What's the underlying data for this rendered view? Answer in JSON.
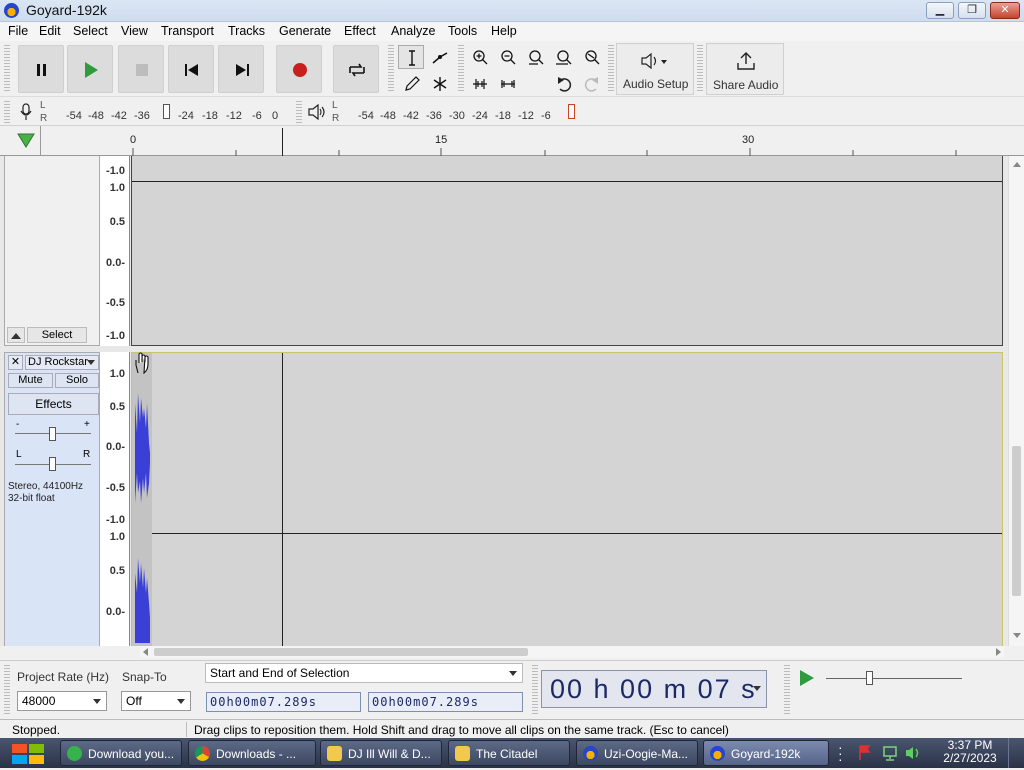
{
  "window": {
    "title": "Goyard-192k",
    "min_label": "▭",
    "max_label": "⧉",
    "close_label": "✕"
  },
  "menu": [
    "File",
    "Edit",
    "Select",
    "View",
    "Transport",
    "Tracks",
    "Generate",
    "Effect",
    "Analyze",
    "Tools",
    "Help"
  ],
  "toolbar": {
    "audio_setup_label": "Audio Setup",
    "share_audio_label": "Share Audio"
  },
  "meters": {
    "rec_scale": [
      "-54",
      "-48",
      "-42",
      "-36",
      "-24",
      "-18",
      "-12",
      "-6",
      "0"
    ],
    "play_scale": [
      "-54",
      "-48",
      "-42",
      "-36",
      "-30",
      "-24",
      "-18",
      "-12",
      "-6"
    ],
    "l": "L",
    "r": "R"
  },
  "timeline": {
    "labels": [
      "0",
      "15",
      "30"
    ]
  },
  "track1": {
    "select_label": "Select",
    "ruler": [
      "-1.0",
      "1.0",
      "0.5",
      "0.0-",
      "-0.5",
      "-1.0"
    ]
  },
  "track2": {
    "name": "DJ Rockstar",
    "mute": "Mute",
    "solo": "Solo",
    "effects": "Effects",
    "gain_minus": "-",
    "gain_plus": "+",
    "pan_l": "L",
    "pan_r": "R",
    "info_line1": "Stereo, 44100Hz",
    "info_line2": "32-bit float",
    "ruler_top": [
      "1.0",
      "0.5",
      "0.0-",
      "-0.5",
      "-1.0"
    ],
    "ruler_bottom": [
      "1.0",
      "0.5",
      "0.0-"
    ]
  },
  "selection": {
    "project_rate_label": "Project Rate (Hz)",
    "project_rate_value": "48000",
    "snap_to_label": "Snap-To",
    "snap_to_value": "Off",
    "mode": "Start and End of Selection",
    "start": "00h00m07.289s",
    "end": "00h00m07.289s",
    "big_time": "00 h 00 m 07 s"
  },
  "status": {
    "state": "Stopped.",
    "hint": "Drag clips to reposition them. Hold Shift and drag to move all clips on the same track. (Esc to cancel)"
  },
  "taskbar": {
    "tasks": [
      {
        "label": "Download you...",
        "color": "#36b34a"
      },
      {
        "label": "Downloads - ...",
        "color": "#e9b72a"
      },
      {
        "label": "DJ Ill Will & D...",
        "color": "#f2c94c"
      },
      {
        "label": "The Citadel",
        "color": "#f2c94c"
      },
      {
        "label": "Uzi-Oogie-Ma...",
        "color": "#2546c8"
      },
      {
        "label": "Goyard-192k",
        "color": "#2546c8"
      }
    ],
    "time": "3:37 PM",
    "date": "2/27/2023"
  }
}
